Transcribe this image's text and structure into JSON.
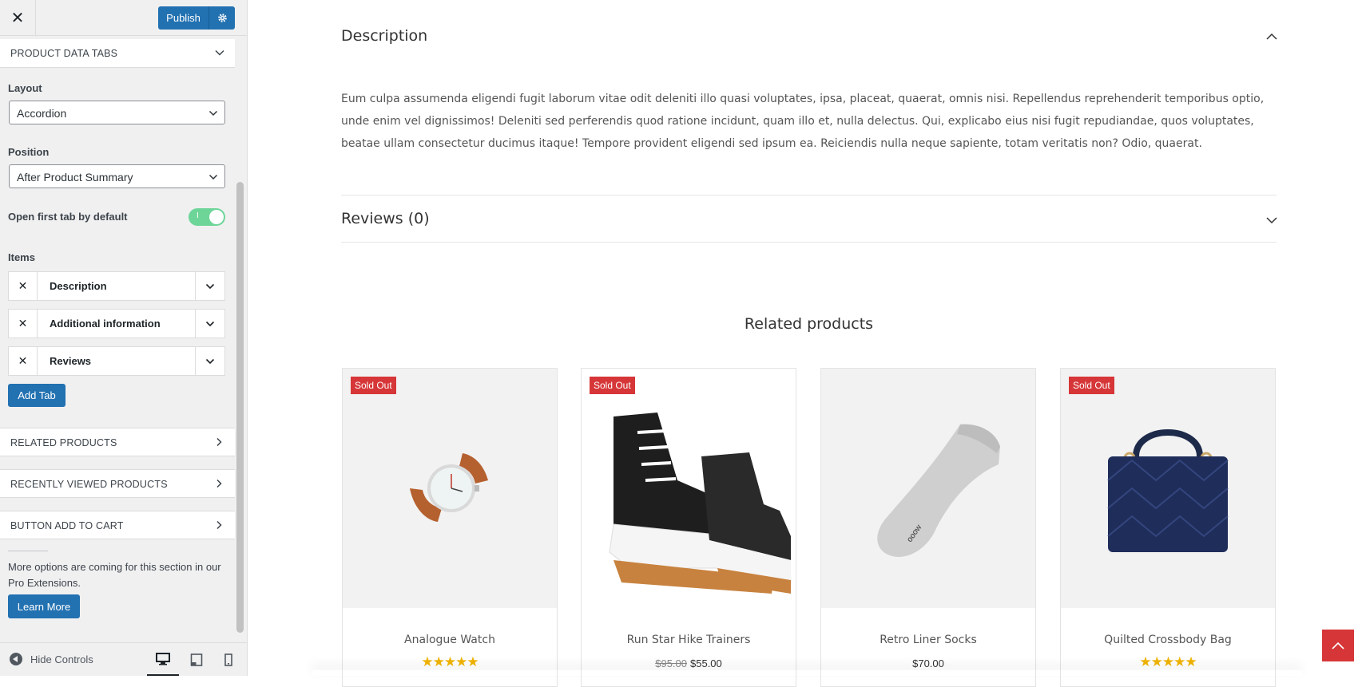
{
  "sidebar": {
    "close_label": "✕",
    "publish_label": "Publish",
    "section_title": "PRODUCT DATA TABS",
    "layout": {
      "label": "Layout",
      "value": "Accordion"
    },
    "position": {
      "label": "Position",
      "value": "After Product Summary"
    },
    "open_first_tab": {
      "label": "Open first tab by default",
      "state": "I"
    },
    "items_label": "Items",
    "items": [
      {
        "label": "Description"
      },
      {
        "label": "Additional information"
      },
      {
        "label": "Reviews"
      }
    ],
    "add_tab_label": "Add Tab",
    "panels": [
      {
        "label": "RELATED PRODUCTS"
      },
      {
        "label": "RECENTLY VIEWED PRODUCTS"
      },
      {
        "label": "BUTTON ADD TO CART"
      }
    ],
    "more_text": "More options are coming for this section in our Pro Extensions.",
    "learn_more_label": "Learn More",
    "hide_controls_label": "Hide Controls"
  },
  "preview": {
    "description_title": "Description",
    "description_body": "Eum culpa assumenda eligendi fugit laborum vitae odit deleniti illo quasi voluptates, ipsa, placeat, quaerat, omnis nisi. Repellendus reprehenderit temporibus optio, unde enim vel dignissimos! Deleniti sed perferendis quod ratione incidunt, quam illo et, nulla delectus. Qui, explicabo eius nisi fugit repudiandae, quos voluptates, beatae ullam consectetur ducimus itaque! Tempore provident eligendi sed ipsum ea. Reiciendis nulla neque sapiente, totam veritatis non? Odio, quaerat.",
    "reviews_title": "Reviews (0)",
    "related_title": "Related products",
    "products": [
      {
        "name": "Analogue Watch",
        "badge": "Sold Out",
        "rating": 5,
        "stars": "★★★★★",
        "icon": "watch-image"
      },
      {
        "name": "Run Star Hike Trainers",
        "badge": "Sold Out",
        "old_price": "$95.00",
        "price": "$55.00",
        "icon": "sneaker-image"
      },
      {
        "name": "Retro Liner Socks",
        "badge": "",
        "price": "$70.00",
        "icon": "sock-image"
      },
      {
        "name": "Quilted Crossbody Bag",
        "badge": "Sold Out",
        "rating": 5,
        "stars": "★★★★★",
        "icon": "bag-image"
      }
    ]
  },
  "colors": {
    "accent": "#2271b1",
    "sold_out": "#d63638",
    "toggle_on": "#6dd598",
    "star": "#f0b400"
  }
}
